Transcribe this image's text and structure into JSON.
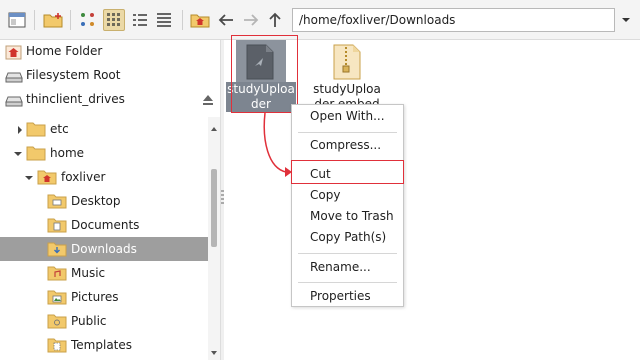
{
  "toolbar": {
    "path_value": "/home/foxliver/Downloads",
    "buttons": [
      "new-window-icon",
      "new-folder-icon",
      "icon-view-icon",
      "thumbnail-view-icon",
      "compact-view-icon",
      "list-view-icon",
      "home-icon",
      "back-arrow-icon",
      "forward-arrow-icon",
      "up-arrow-icon"
    ],
    "active_view": "thumbnail-view-icon"
  },
  "places": [
    {
      "label": "Home Folder",
      "icon": "home-folder-icon"
    },
    {
      "label": "Filesystem Root",
      "icon": "drive-icon"
    },
    {
      "label": "thinclient_drives",
      "icon": "drive-icon"
    }
  ],
  "tree": [
    {
      "label": "etc",
      "expanded": false
    },
    {
      "label": "home",
      "expanded": true
    },
    {
      "label": "foxliver",
      "expanded": true
    },
    {
      "label": "Desktop"
    },
    {
      "label": "Documents"
    },
    {
      "label": "Downloads",
      "selected": true
    },
    {
      "label": "Music"
    },
    {
      "label": "Pictures"
    },
    {
      "label": "Public"
    },
    {
      "label": "Templates"
    }
  ],
  "files": [
    {
      "name": "studyUploader",
      "selected": true,
      "icon": "document-icon"
    },
    {
      "name": "studyUploader-embedd",
      "selected": false,
      "icon": "archive-icon"
    }
  ],
  "context_menu": [
    {
      "label": "Open With..."
    },
    {
      "label": "Compress..."
    },
    {
      "label": "Cut",
      "highlighted": true
    },
    {
      "label": "Copy"
    },
    {
      "label": "Move to Trash"
    },
    {
      "label": "Copy Path(s)"
    },
    {
      "label": "Rename..."
    },
    {
      "label": "Properties"
    }
  ],
  "colors": {
    "selection": "#9e9e9e",
    "annotation": "#e0303a",
    "folder": "#f2c96b"
  }
}
